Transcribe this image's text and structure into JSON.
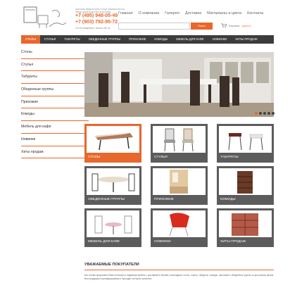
{
  "header": {
    "slogan": "МАГАЗИН МЕБЕЛИ ДЛЯ КУХНИ ОФИЦИАЛЬНОЕ ПРЕДСТАВИТЕЛЬСТВО В МОСКВЕ",
    "phone1": "+7 (495) 948-05-49",
    "phone2": "+7 (903) 792-95-72",
    "address": "10-18 ежедневно, Кросно 85, кс.",
    "nav": [
      "Главная",
      "О компании",
      "Галерея",
      "Доставка",
      "Материалы и цвета",
      "Контакты"
    ],
    "search_button": "Поиск",
    "cart_label": "Корзина",
    "cart_count": "(пусто)"
  },
  "menu": [
    "СТОЛЫ",
    "СТУЛЬЯ",
    "ТАБУРЕТЫ",
    "ОБЕДЕННЫЕ ГРУППЫ",
    "ПРИХОЖИЕ",
    "КОМОДЫ",
    "МЕБЕЛЬ ДЛЯ КАФЕ",
    "НОВИНКИ",
    "ХИТЫ ПРОДАЖ"
  ],
  "sidebar": [
    "Столы",
    "Стулья",
    "Табуреты",
    "Обеденные группы",
    "Прихожие",
    "Комоды",
    "Мебель для кафе",
    "Новинки",
    "Хиты продаж"
  ],
  "tiles": [
    "СТОЛЫ",
    "СТУЛЬЯ",
    "ТАБУРЕТЫ",
    "ОБЕДЕННЫЕ ГРУППЫ",
    "ПРИХОЖИЕ",
    "КОМОДЫ",
    "МЕБЕЛЬ ДЛЯ КАФЕ",
    "НОВИНКИ",
    "ХИТЫ ПРОДАЖ"
  ],
  "about": {
    "title": "УВАЖАЕМЫЕ ПОКУПАТЕЛИ",
    "text": "Мы готовы предложить Вам стильную и надёжную мебель с доставкой в Москве: раскладные столы, стулья, табуреты, комоды, прихожие и обеденные группы по доступным ценам. Вся продукция сертифицирована и проходит контроль качества."
  },
  "colors": {
    "accent": "#e8672c",
    "menu": "#3c3c3c",
    "tile": "#5c5c5c"
  }
}
